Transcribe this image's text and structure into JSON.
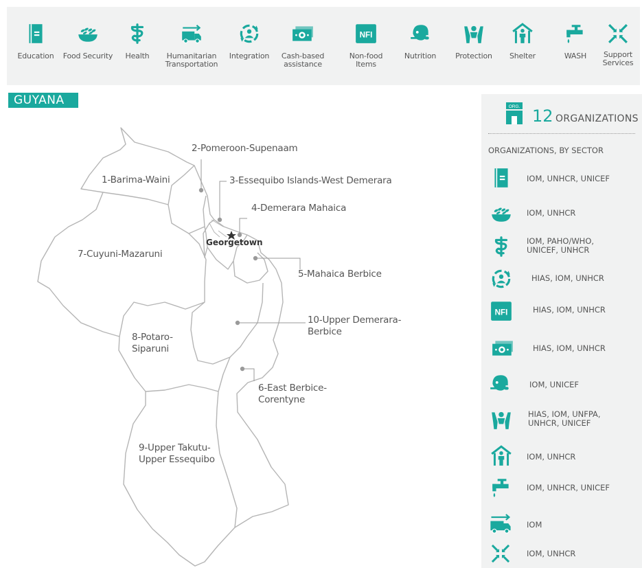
{
  "sectors": [
    {
      "icon": "education-icon",
      "label": "Education"
    },
    {
      "icon": "food-security-icon",
      "label": "Food Security"
    },
    {
      "icon": "health-icon",
      "label": "Health"
    },
    {
      "icon": "humanitarian-transportation-icon",
      "label": "Humanitarian Transportation"
    },
    {
      "icon": "integration-icon",
      "label": "Integration"
    },
    {
      "icon": "cash-based-assistance-icon",
      "label": "Cash-based assistance"
    },
    {
      "icon": "nfi-icon",
      "label": "Non-food Items"
    },
    {
      "icon": "nutrition-icon",
      "label": "Nutrition"
    },
    {
      "icon": "protection-icon",
      "label": "Protection"
    },
    {
      "icon": "shelter-icon",
      "label": "Shelter"
    },
    {
      "icon": "wash-icon",
      "label": "WASH"
    },
    {
      "icon": "support-services-icon",
      "label": "Support Services"
    }
  ],
  "country": "GUYANA",
  "city": "Georgetown",
  "regions": [
    "1-Barima-Waini",
    "2-Pomeroon-Supenaam",
    "3-Essequibo Islands-West Demerara",
    "4-Demerara Mahaica",
    "5-Mahaica Berbice",
    "6-East Berbice-Corentyne",
    "7-Cuyuni-Mazaruni",
    "8-Potaro-Siparuni",
    "9-Upper Takutu-Upper Essequibo",
    "10-Upper Demerara-Berbice"
  ],
  "panel": {
    "org_badge": "ORG.",
    "count": "12",
    "count_label": "ORGANIZATIONS",
    "by_sector_label": "ORGANIZATIONS, BY SECTOR",
    "rows": [
      {
        "icon": "education-icon",
        "orgs": "IOM, UNHCR, UNICEF"
      },
      {
        "icon": "food-security-icon",
        "orgs": "IOM, UNHCR"
      },
      {
        "icon": "health-icon",
        "orgs": "IOM, PAHO/WHO, UNICEF, UNHCR"
      },
      {
        "icon": "integration-icon",
        "orgs": "HIAS, IOM, UNHCR"
      },
      {
        "icon": "nfi-icon",
        "orgs": "HIAS, IOM, UNHCR"
      },
      {
        "icon": "cash-based-assistance-icon",
        "orgs": "HIAS, IOM, UNHCR"
      },
      {
        "icon": "nutrition-icon",
        "orgs": "IOM, UNICEF"
      },
      {
        "icon": "protection-icon",
        "orgs": "HIAS, IOM, UNFPA, UNHCR, UNICEF"
      },
      {
        "icon": "shelter-icon",
        "orgs": "IOM, UNHCR"
      },
      {
        "icon": "wash-icon",
        "orgs": "IOM, UNHCR, UNICEF"
      },
      {
        "icon": "humanitarian-transportation-icon",
        "orgs": "IOM"
      },
      {
        "icon": "support-services-icon",
        "orgs": "IOM, UNHCR"
      }
    ]
  },
  "nfi_text": "NFI",
  "colors": {
    "accent": "#1aa99e",
    "panel_bg": "#f1f2f2",
    "map_line": "#b5b5b5"
  }
}
